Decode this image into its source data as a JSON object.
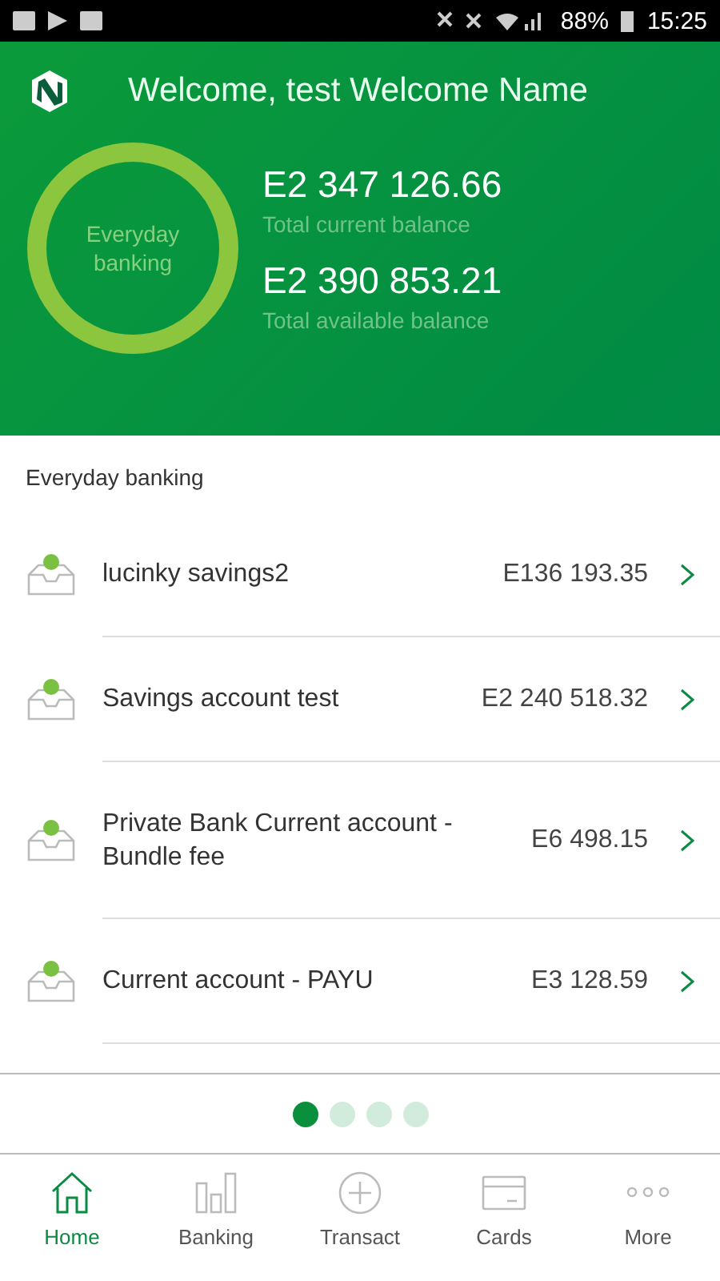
{
  "status_bar": {
    "battery": "88%",
    "time": "15:25"
  },
  "header": {
    "title": "Welcome, test Welcome Name",
    "ring_label": "Everyday banking",
    "balances": [
      {
        "amount": "E2 347 126.66",
        "label": "Total current balance"
      },
      {
        "amount": "E2 390 853.21",
        "label": "Total available balance"
      }
    ]
  },
  "section_title": "Everyday banking",
  "accounts": [
    {
      "name": "lucinky savings2",
      "amount": "E136 193.35"
    },
    {
      "name": "Savings account test",
      "amount": "E2 240 518.32"
    },
    {
      "name": "Private Bank Current account - Bundle fee",
      "amount": "E6 498.15"
    },
    {
      "name": "Current account - PAYU",
      "amount": "E3 128.59"
    }
  ],
  "pager": [
    {
      "selected": true
    },
    {
      "selected": false
    },
    {
      "selected": false
    },
    {
      "selected": false
    }
  ],
  "nav": [
    {
      "kind": "home",
      "label": "Home",
      "selected": true
    },
    {
      "kind": "banking",
      "label": "Banking",
      "selected": false
    },
    {
      "kind": "transact",
      "label": "Transact",
      "selected": false
    },
    {
      "kind": "cards",
      "label": "Cards",
      "selected": false
    },
    {
      "kind": "more",
      "label": "More",
      "selected": false
    }
  ]
}
